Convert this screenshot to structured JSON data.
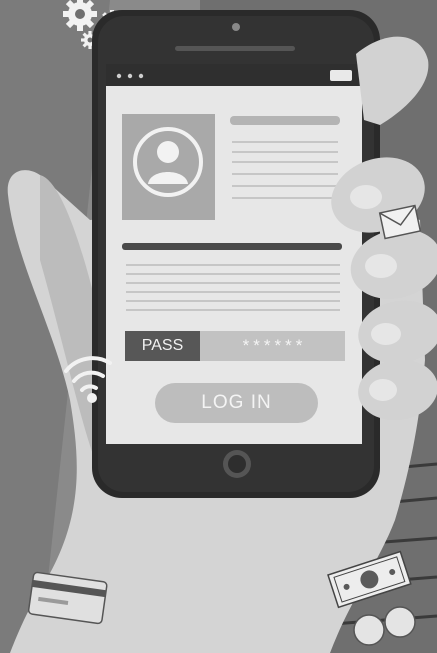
{
  "form": {
    "pass_label": "PASS",
    "pass_mask": "******",
    "login_label": "LOG IN"
  },
  "colors": {
    "background": "#6e6e6e",
    "phone_body": "#2b2b2b",
    "screen": "#e6e6e6",
    "hand": "#d3d3d3",
    "login_button": "#bdbdbd",
    "pass_tag": "#5a5a5a"
  },
  "icons": [
    "gear-icon",
    "user-avatar-icon",
    "envelope-icon",
    "wifi-icon",
    "credit-card-icon",
    "banknote-icon",
    "coin-icon",
    "battery-icon"
  ]
}
